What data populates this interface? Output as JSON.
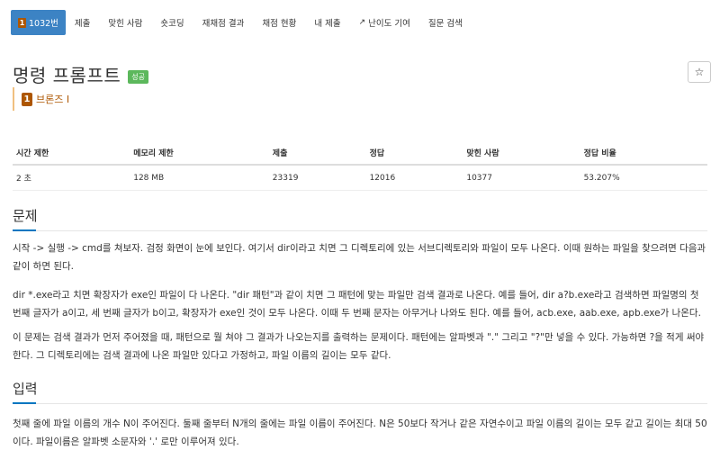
{
  "tabs": [
    {
      "label": "1032번",
      "active": true,
      "badge": "1"
    },
    {
      "label": "제출"
    },
    {
      "label": "맞힌 사람"
    },
    {
      "label": "숏코딩"
    },
    {
      "label": "재채점 결과"
    },
    {
      "label": "채점 현황"
    },
    {
      "label": "내 제출"
    },
    {
      "label": "난이도 기여",
      "icon": "external-link-icon"
    },
    {
      "label": "질문 검색"
    }
  ],
  "problem": {
    "title": "명령 프롬프트",
    "status": "성공",
    "star": "☆",
    "tier_icon": "1",
    "tier_label": "브론즈 I"
  },
  "info_table": {
    "headers": [
      "시간 제한",
      "메모리 제한",
      "제출",
      "정답",
      "맞힌 사람",
      "정답 비율"
    ],
    "values": [
      "2 초",
      "128 MB",
      "23319",
      "12016",
      "10377",
      "53.207%"
    ]
  },
  "sections": {
    "problem_heading": "문제",
    "problem_p1": "시작 -> 실행 -> cmd를 쳐보자. 검정 화면이 눈에 보인다. 여기서 dir이라고 치면 그 디렉토리에 있는 서브디렉토리와 파일이 모두 나온다. 이때 원하는 파일을 찾으려면 다음과 같이 하면 된다.",
    "problem_p2": "dir *.exe라고 치면 확장자가 exe인 파일이 다 나온다. \"dir 패턴\"과 같이 치면 그 패턴에 맞는 파일만 검색 결과로 나온다. 예를 들어, dir a?b.exe라고 검색하면 파일명의 첫 번째 글자가 a이고, 세 번째 글자가 b이고, 확장자가 exe인 것이 모두 나온다. 이때 두 번째 문자는 아무거나 나와도 된다. 예를 들어, acb.exe, aab.exe, apb.exe가 나온다.",
    "problem_p3": "이 문제는 검색 결과가 먼저 주어졌을 때, 패턴으로 뭘 쳐야 그 결과가 나오는지를 출력하는 문제이다. 패턴에는 알파벳과 \".\" 그리고 \"?\"만 넣을 수 있다. 가능하면 ?을 적게 써야 한다. 그 디렉토리에는 검색 결과에 나온 파일만 있다고 가정하고, 파일 이름의 길이는 모두 같다.",
    "input_heading": "입력",
    "input_p1": "첫째 줄에 파일 이름의 개수 N이 주어진다. 둘째 줄부터 N개의 줄에는 파일 이름이 주어진다. N은 50보다 작거나 같은 자연수이고 파일 이름의 길이는 모두 같고 길이는 최대 50이다. 파일이름은 알파벳 소문자와 '.' 로만 이루어져 있다."
  }
}
